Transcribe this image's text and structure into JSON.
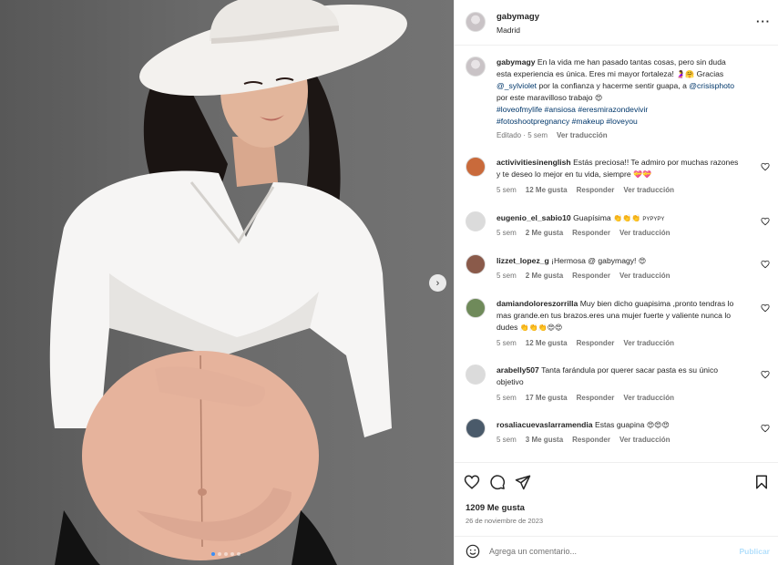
{
  "post": {
    "username": "gabymagy",
    "location": "Madrid",
    "more_icon": "more-horizontal-icon"
  },
  "caption": {
    "username": "gabymagy",
    "text1": "En la vida me han pasado tantas cosas, pero sin duda esta experiencia es única. Eres mi mayor fortaleza!",
    "emojis1": "🤰🤗",
    "text2": "Gracias",
    "mention1": "@_sylviolet",
    "text3": "por la confianza y hacerme sentir guapa, a",
    "mention2": "@crisisphoto",
    "text4": "por este maravilloso trabajo",
    "emojis2": "😍",
    "hashtags_line1": "#loveofmylife #ansiosa #eresmirazondevivir",
    "hashtags_line2": "#fotoshootpregnancy #makeup #loveyou",
    "edited": "Editado · 5 sem",
    "translate": "Ver traducción"
  },
  "comments": [
    {
      "username": "activivitiesinenglish",
      "text": "Estás preciosa!! Te admiro por muchas razones y te deseo lo mejor en tu vida, siempre",
      "emojis": "💝💝",
      "time": "5 sem",
      "likes": "12 Me gusta",
      "reply": "Responder",
      "translate": "Ver traducción",
      "avatar_color": "#c96a3b"
    },
    {
      "username": "eugenio_el_sabio10",
      "text": "Guapísima",
      "emojis": "👏👏👏",
      "suffix": "PYPYPY",
      "time": "5 sem",
      "likes": "2 Me gusta",
      "reply": "Responder",
      "translate": "Ver traducción",
      "avatar_color": "#dbdbdb"
    },
    {
      "username": "lizzet_lopez_g",
      "text": "¡Hermosa @ gabymagy!",
      "emojis": "😍",
      "time": "5 sem",
      "likes": "2 Me gusta",
      "reply": "Responder",
      "translate": "Ver traducción",
      "avatar_color": "#8a5a4a"
    },
    {
      "username": "damiandoloreszorrilla",
      "text": "Muy bien dicho guapisima ,pronto tendras lo mas grande.en tus brazos.eres una mujer fuerte y valiente nunca lo dudes",
      "emojis": "👏👏👏😍😍",
      "time": "5 sem",
      "likes": "12 Me gusta",
      "reply": "Responder",
      "translate": "Ver traducción",
      "avatar_color": "#6f8a5a"
    },
    {
      "username": "arabelly507",
      "text": "Tanta farándula por querer sacar pasta es su único objetivo",
      "emojis": "",
      "time": "5 sem",
      "likes": "17 Me gusta",
      "reply": "Responder",
      "translate": "Ver traducción",
      "avatar_color": "#dbdbdb"
    },
    {
      "username": "rosaliacuevaslarramendia",
      "text": "Estas guapina",
      "emojis": "😍😍😍",
      "time": "5 sem",
      "likes": "3 Me gusta",
      "reply": "Responder",
      "translate": "Ver traducción",
      "avatar_color": "#4a5a6a"
    }
  ],
  "actions": {
    "like_icon": "heart-icon",
    "comment_icon": "comment-icon",
    "share_icon": "send-icon",
    "save_icon": "bookmark-icon",
    "likes": "1209 Me gusta",
    "date": "26 de noviembre de 2023"
  },
  "add_comment": {
    "emoji_icon": "smiley-icon",
    "placeholder": "Agrega un comentario...",
    "publish": "Publicar"
  },
  "carousel": {
    "next_icon": "chevron-right-icon",
    "slides": 5,
    "current": 1
  },
  "colors": {
    "link": "#00376b",
    "muted": "#737373",
    "publish_disabled": "#b2dffc",
    "dot_active": "#3a8ef6"
  }
}
